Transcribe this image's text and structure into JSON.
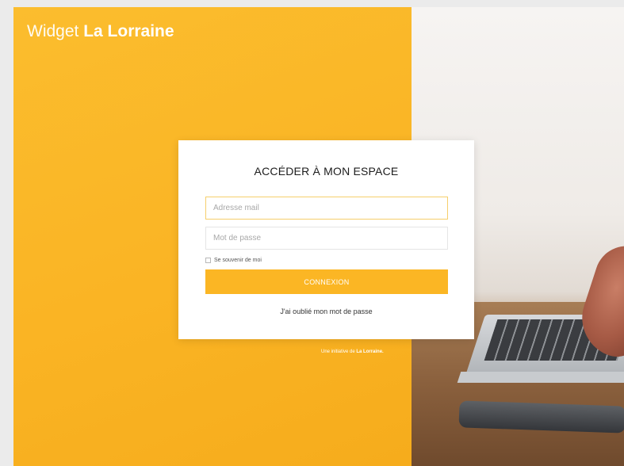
{
  "brand": {
    "prefix": "Widget",
    "name": "La Lorraine"
  },
  "login": {
    "title": "ACCÉDER À MON ESPACE",
    "email_placeholder": "Adresse mail",
    "password_placeholder": "Mot de passe",
    "remember_label": "Se souvenir de moi",
    "submit_label": "CONNEXION",
    "forgot_label": "J'ai oublié mon mot de passe"
  },
  "footer": {
    "prefix": "Une initiative de",
    "brand": "La Lorraine."
  },
  "colors": {
    "accent": "#fbb624",
    "panel": "#fab424",
    "card": "#ffffff"
  }
}
